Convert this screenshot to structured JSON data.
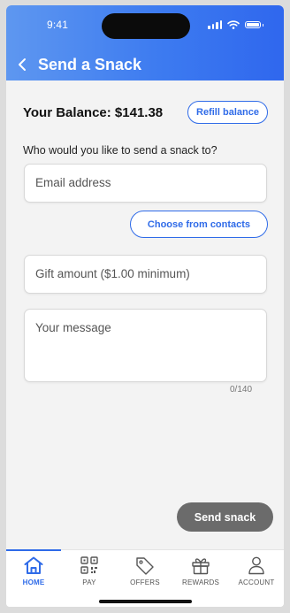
{
  "status_bar": {
    "time": "9:41"
  },
  "header": {
    "title": "Send a Snack"
  },
  "balance": {
    "text": "Your Balance: $141.38",
    "refill_label": "Refill balance"
  },
  "form": {
    "prompt": "Who would you like to send a snack to?",
    "email_placeholder": "Email address",
    "contacts_label": "Choose from contacts",
    "amount_placeholder": "Gift amount ($1.00 minimum)",
    "message_placeholder": "Your message",
    "counter": "0/140",
    "send_label": "Send snack"
  },
  "tabs": [
    {
      "label": "HOME",
      "icon": "home-icon",
      "active": true
    },
    {
      "label": "PAY",
      "icon": "qr-code-icon",
      "active": false
    },
    {
      "label": "OFFERS",
      "icon": "tag-icon",
      "active": false
    },
    {
      "label": "REWARDS",
      "icon": "gift-icon",
      "active": false
    },
    {
      "label": "ACCOUNT",
      "icon": "person-icon",
      "active": false
    }
  ],
  "colors": {
    "accent": "#2f6be8",
    "header_gradient_start": "#5e97f0",
    "header_gradient_end": "#2f67ee",
    "send_button": "#6b6b6b"
  }
}
